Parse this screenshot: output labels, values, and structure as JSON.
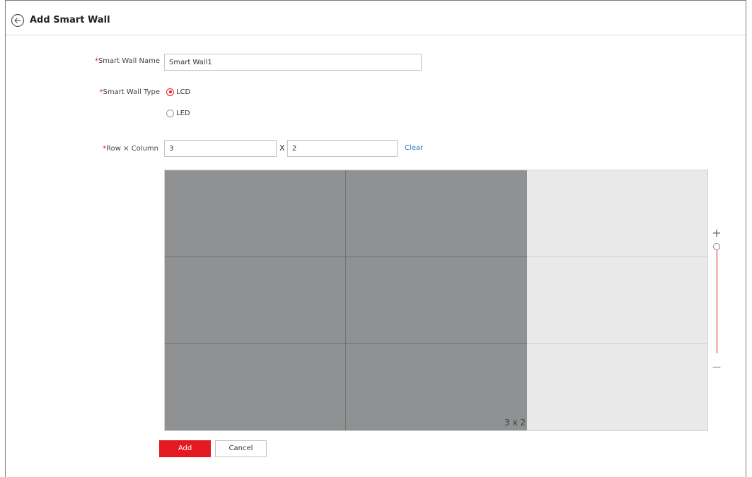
{
  "header": {
    "title": "Add Smart Wall"
  },
  "form": {
    "name_label": "Smart Wall Name",
    "name_value": "Smart Wall1",
    "type_label": "Smart Wall Type",
    "type_options": [
      "LCD",
      "LED"
    ],
    "type_selected": "LCD",
    "row_col_label": "Row × Column",
    "rows": "3",
    "cols": "2",
    "separator": "X",
    "clear_label": "Clear",
    "required_mark": "*"
  },
  "wall": {
    "label": "3 x 2"
  },
  "zoom": {
    "plus": "+",
    "minus": "—"
  },
  "actions": {
    "add": "Add",
    "cancel": "Cancel"
  },
  "colors": {
    "accent": "#e21b23",
    "link": "#1e76d3",
    "wall_fill": "#909192",
    "canvas_bg": "#e9e9e9"
  }
}
